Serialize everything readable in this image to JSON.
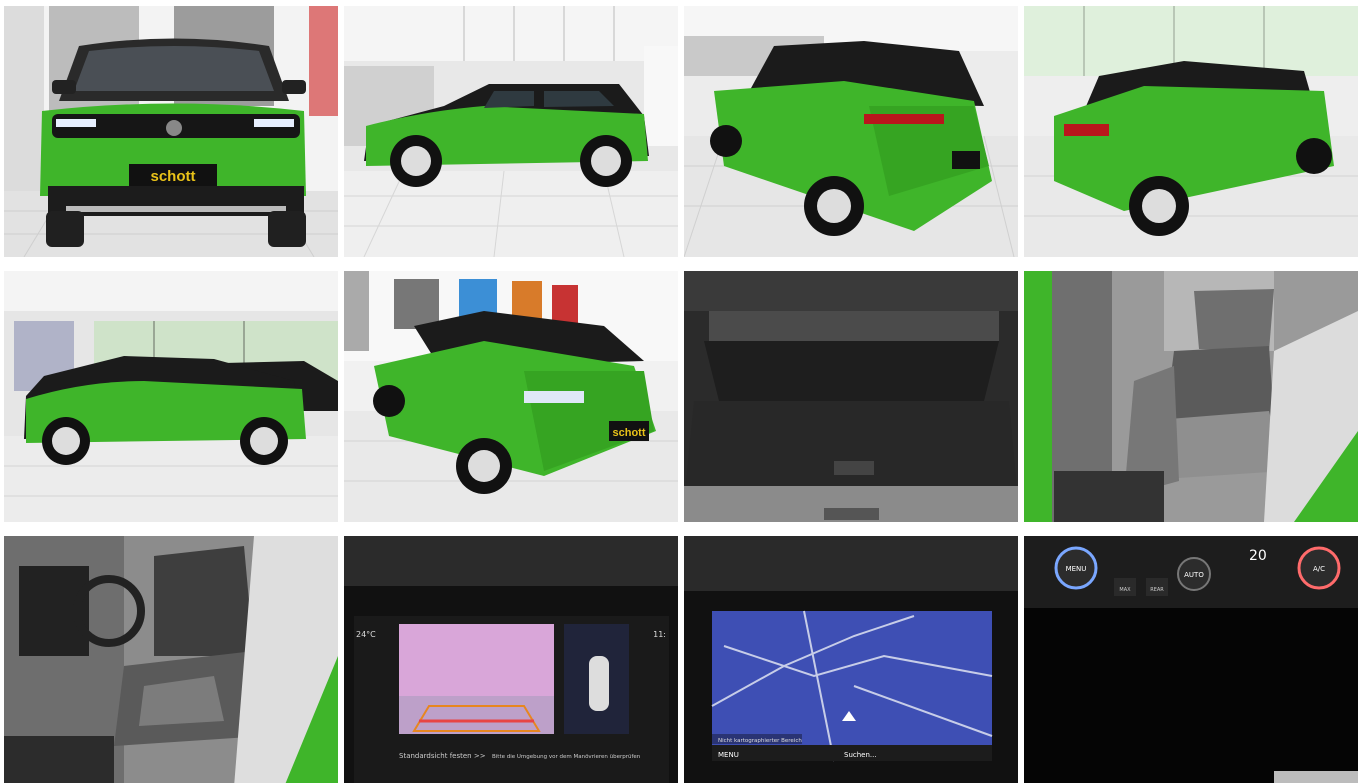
{
  "gallery": {
    "dealer_plate": "schott",
    "tiles": [
      {
        "id": 1,
        "label": "front"
      },
      {
        "id": 2,
        "label": "side-left"
      },
      {
        "id": 3,
        "label": "rear-three-quarter-left"
      },
      {
        "id": 4,
        "label": "rear-three-quarter-right"
      },
      {
        "id": 5,
        "label": "side-left-exterior"
      },
      {
        "id": 6,
        "label": "front-three-quarter-right"
      },
      {
        "id": 7,
        "label": "trunk"
      },
      {
        "id": 8,
        "label": "rear-seats"
      },
      {
        "id": 9,
        "label": "front-seats"
      },
      {
        "id": 10,
        "label": "rear-camera-display"
      },
      {
        "id": 11,
        "label": "navigation-display"
      },
      {
        "id": 12,
        "label": "climate-control"
      }
    ],
    "camera_screen": {
      "temp": "24°C",
      "time": "11:",
      "bottom_left": "Standardsicht festen >>",
      "bottom_right": "Bitte die Umgebung vor dem Manövrieren überprüfen"
    },
    "nav_screen": {
      "status": "Nicht kartographierter Bereich",
      "menu_label": "MENU",
      "search_label": "Suchen..."
    },
    "climate": {
      "temperature": "20",
      "left_knob": "MENU",
      "center_knob": "AUTO",
      "right_knob": "A/C",
      "button_max": "MAX",
      "button_rear": "REAR"
    }
  },
  "colors": {
    "car_green": "#3fb52a",
    "car_black": "#1b1b1b",
    "floor": "#e9e9e9",
    "screen_blue": "#3e4fb4"
  }
}
